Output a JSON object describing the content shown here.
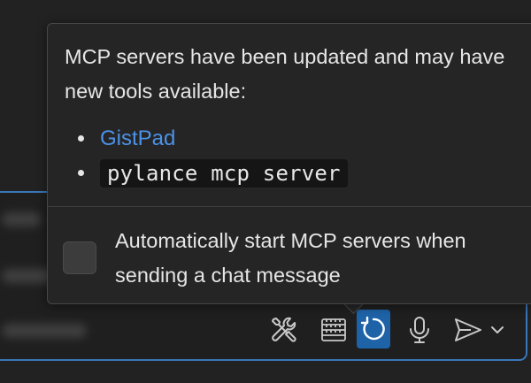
{
  "popup": {
    "message": "MCP servers have been updated and may have new tools available:",
    "servers": [
      {
        "label": "GistPad",
        "kind": "link"
      },
      {
        "label": "pylance mcp server",
        "kind": "code"
      }
    ],
    "auto_start_label": "Automatically start MCP servers when sending a chat message",
    "auto_start_checked": false
  },
  "toolbar": {
    "icons": [
      "tools-icon",
      "context-icon",
      "refresh-icon",
      "microphone-icon",
      "send-icon",
      "chevron-down-icon"
    ]
  },
  "colors": {
    "accent": "#3a76b8",
    "link": "#4b92e8",
    "active_button": "#1e63a8"
  }
}
